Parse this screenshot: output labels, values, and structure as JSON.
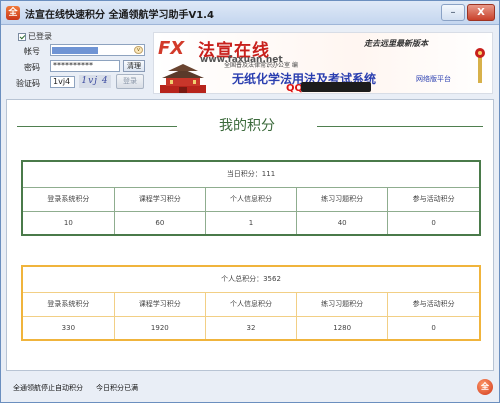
{
  "window": {
    "title": "法宣在线快速积分 全通领航学习助手V1.4",
    "app_icon_glyph": "全",
    "minimize_glyph": "–",
    "close_glyph": "X"
  },
  "login": {
    "status_label": "已登录",
    "account_label": "帐号",
    "password_label": "密码",
    "password_value": "**********",
    "clear_button": "清理",
    "captcha_label": "验证码",
    "captcha_input": "1vj4",
    "captcha_image_text": "1vj 4",
    "login_button": "登录",
    "dropdown_glyph": "v"
  },
  "banner": {
    "logo_fx": "FX",
    "site_name": "法宣在线",
    "url": "www.faxuan.net",
    "slogan": "走去远里最新版本",
    "sponsor": "全国普及法律常识办公室 编",
    "motto": "无纸化学法用法及考试系统",
    "qq_prefix": "QQ:",
    "platform": "网络版平台"
  },
  "main": {
    "heading": "我的积分",
    "today": {
      "caption": "当日积分：111",
      "headers": [
        "登录系统积分",
        "课程学习积分",
        "个人信息积分",
        "练习习题积分",
        "参与活动积分"
      ],
      "values": [
        "10",
        "60",
        "1",
        "40",
        "0"
      ]
    },
    "total": {
      "caption": "个人总积分：3562",
      "headers": [
        "登录系统积分",
        "课程学习积分",
        "个人信息积分",
        "练习习题积分",
        "参与活动积分"
      ],
      "values": [
        "330",
        "1920",
        "32",
        "1280",
        "0"
      ]
    }
  },
  "status": {
    "left": "全通领航停止自动积分",
    "middle": "今日积分已满",
    "icon_glyph": "全"
  },
  "colors": {
    "today_border": "#4a7a4a",
    "total_border": "#f0b43c",
    "heading_green": "#3b6a3b"
  }
}
